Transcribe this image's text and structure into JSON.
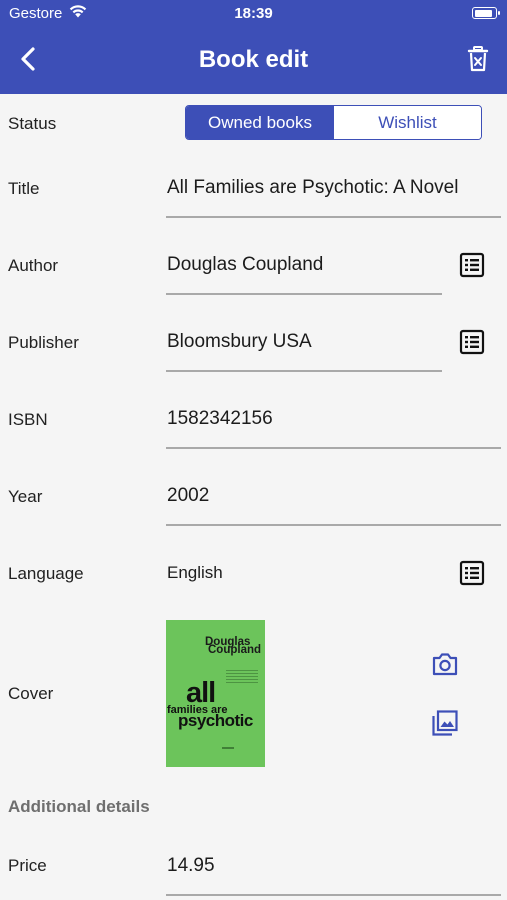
{
  "status_bar": {
    "carrier": "Gestore",
    "time": "18:39",
    "battery_level": 0.9
  },
  "header": {
    "title": "Book edit",
    "back_icon": "chevron-left-icon",
    "delete_icon": "trash-icon"
  },
  "fields": {
    "status": {
      "label": "Status",
      "options": [
        "Owned books",
        "Wishlist"
      ],
      "selected": "Owned books"
    },
    "title": {
      "label": "Title",
      "value": "All Families are Psychotic: A Novel"
    },
    "author": {
      "label": "Author",
      "value": "Douglas Coupland"
    },
    "publisher": {
      "label": "Publisher",
      "value": "Bloomsbury USA"
    },
    "isbn": {
      "label": "ISBN",
      "value": "1582342156"
    },
    "year": {
      "label": "Year",
      "value": "2002"
    },
    "language": {
      "label": "Language",
      "value": "English"
    },
    "cover": {
      "label": "Cover",
      "image_text": {
        "author_line1": "Douglas",
        "author_line2": "Coupland",
        "title_line1": "all",
        "title_line2": "families are",
        "title_line3": "psychotic"
      },
      "background_color": "#6cc45b"
    },
    "price": {
      "label": "Price",
      "value": "14.95"
    }
  },
  "sections": {
    "additional": "Additional details"
  },
  "theme": {
    "primary": "#3d4fb7"
  }
}
